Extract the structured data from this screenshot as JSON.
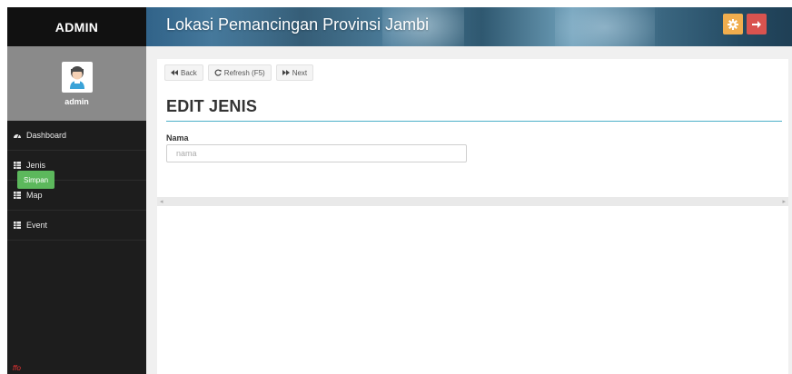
{
  "sidebar": {
    "brand": "ADMIN",
    "user": {
      "name": "admin"
    },
    "items": [
      {
        "label": "Dashboard",
        "icon": "dashboard-icon"
      },
      {
        "label": "Jenis",
        "icon": "table-icon"
      },
      {
        "label": "Map",
        "icon": "table-icon"
      },
      {
        "label": "Event",
        "icon": "table-icon"
      }
    ],
    "bottom_mark": "ffo"
  },
  "header": {
    "title": "Lokasi Pemancingan Provinsi Jambi",
    "buttons": [
      {
        "name": "settings",
        "icon": "gear-icon",
        "color": "#f0ad4e"
      },
      {
        "name": "logout",
        "icon": "arrow-right-icon",
        "color": "#d9534f"
      }
    ]
  },
  "toolbar": {
    "back_label": "Back",
    "refresh_label": "Refresh (F5)",
    "next_label": "Next"
  },
  "form": {
    "title": "EDIT JENIS",
    "nama_label": "Nama",
    "nama_placeholder": "nama",
    "nama_value": "",
    "submit_label": "Simpan"
  },
  "colors": {
    "sidebar_bg": "#1d1d1d",
    "accent_rule": "#4cb0c8",
    "save_green": "#5cb85c"
  }
}
